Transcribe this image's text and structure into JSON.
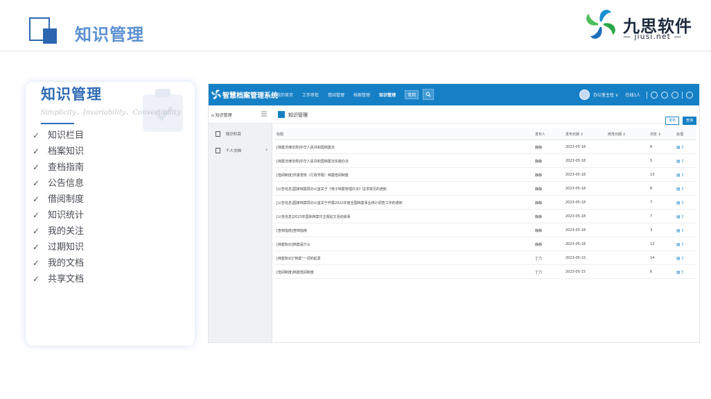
{
  "header": {
    "title": "知识管理",
    "logo_cn": "九思软件",
    "logo_en": "— jiusi.net —"
  },
  "card": {
    "title": "知识管理",
    "subtitle": "Simplicity、Invariability、Convertibility",
    "items": [
      {
        "label": "知识栏目"
      },
      {
        "label": "档案知识"
      },
      {
        "label": "查档指南"
      },
      {
        "label": "公告信息"
      },
      {
        "label": "借阅制度"
      },
      {
        "label": "知识统计"
      },
      {
        "label": "我的关注"
      },
      {
        "label": "过期知识"
      },
      {
        "label": "我的文档"
      },
      {
        "label": "共享文档"
      }
    ]
  },
  "app": {
    "name": "智慧档案管理系统",
    "nav": [
      {
        "label": "我的首页"
      },
      {
        "label": "工作审批"
      },
      {
        "label": "借阅管理"
      },
      {
        "label": "档案管理"
      },
      {
        "label": "知识管理",
        "active": true
      }
    ],
    "common_label": "常用",
    "user": "办公室主任 ∨",
    "online": "在线1人",
    "sidebar": {
      "home": "知识管理",
      "items": [
        {
          "label": "知识栏目"
        },
        {
          "label": "个人文档",
          "arrow": "›"
        }
      ]
    },
    "content": {
      "title": "知识管理",
      "publish_btn": "发布",
      "query_btn": "查询",
      "columns": {
        "title": "标题",
        "publisher": "发布人",
        "pub_date": "发布日期 ⇕",
        "mod_date": "修改日期 ⇕",
        "views": "浏览 ⇕",
        "action": "处理"
      },
      "rows": [
        {
          "title": "[档案法律法规]中华人民共和国档案法",
          "publisher": "静静",
          "date": "2023-05-18",
          "views": "8"
        },
        {
          "title": "[档案法律法规]中华人民共和国档案法实施办法",
          "publisher": "静静",
          "date": "2023-05-18",
          "views": "5"
        },
        {
          "title": "[借阅制度]市委党校（行政学院）档案借阅制度",
          "publisher": "静静",
          "date": "2023-05-18",
          "views": "13"
        },
        {
          "title": "[公告信息]国家档案局办公室关于《电子档案管理办法》征求意见的通知",
          "publisher": "静静",
          "date": "2023-05-18",
          "views": "8"
        },
        {
          "title": "[公告信息]国家档案局办公室关于开展2022年度全国档案事业统计调查工作的通知",
          "publisher": "静静",
          "date": "2023-05-18",
          "views": "7"
        },
        {
          "title": "[公告信息]2023年国际档案日主题征文活动启事",
          "publisher": "静静",
          "date": "2023-05-18",
          "views": "7"
        },
        {
          "title": "[查档指南]查档指南",
          "publisher": "静静",
          "date": "2023-05-18",
          "views": "3"
        },
        {
          "title": "[档案知识]档案是什么",
          "publisher": "静静",
          "date": "2023-05-18",
          "views": "13"
        },
        {
          "title": "[档案知识]\"档案\"一词的起源",
          "publisher": "丁力",
          "date": "2023-05-15",
          "views": "14"
        },
        {
          "title": "[借阅制度]档案借阅制度",
          "publisher": "丁力",
          "date": "2023-05-15",
          "views": "6"
        }
      ]
    }
  },
  "colors": {
    "primary": "#1680c6",
    "title_blue": "#2f6bb5",
    "header_blue": "#5b8fd0"
  }
}
